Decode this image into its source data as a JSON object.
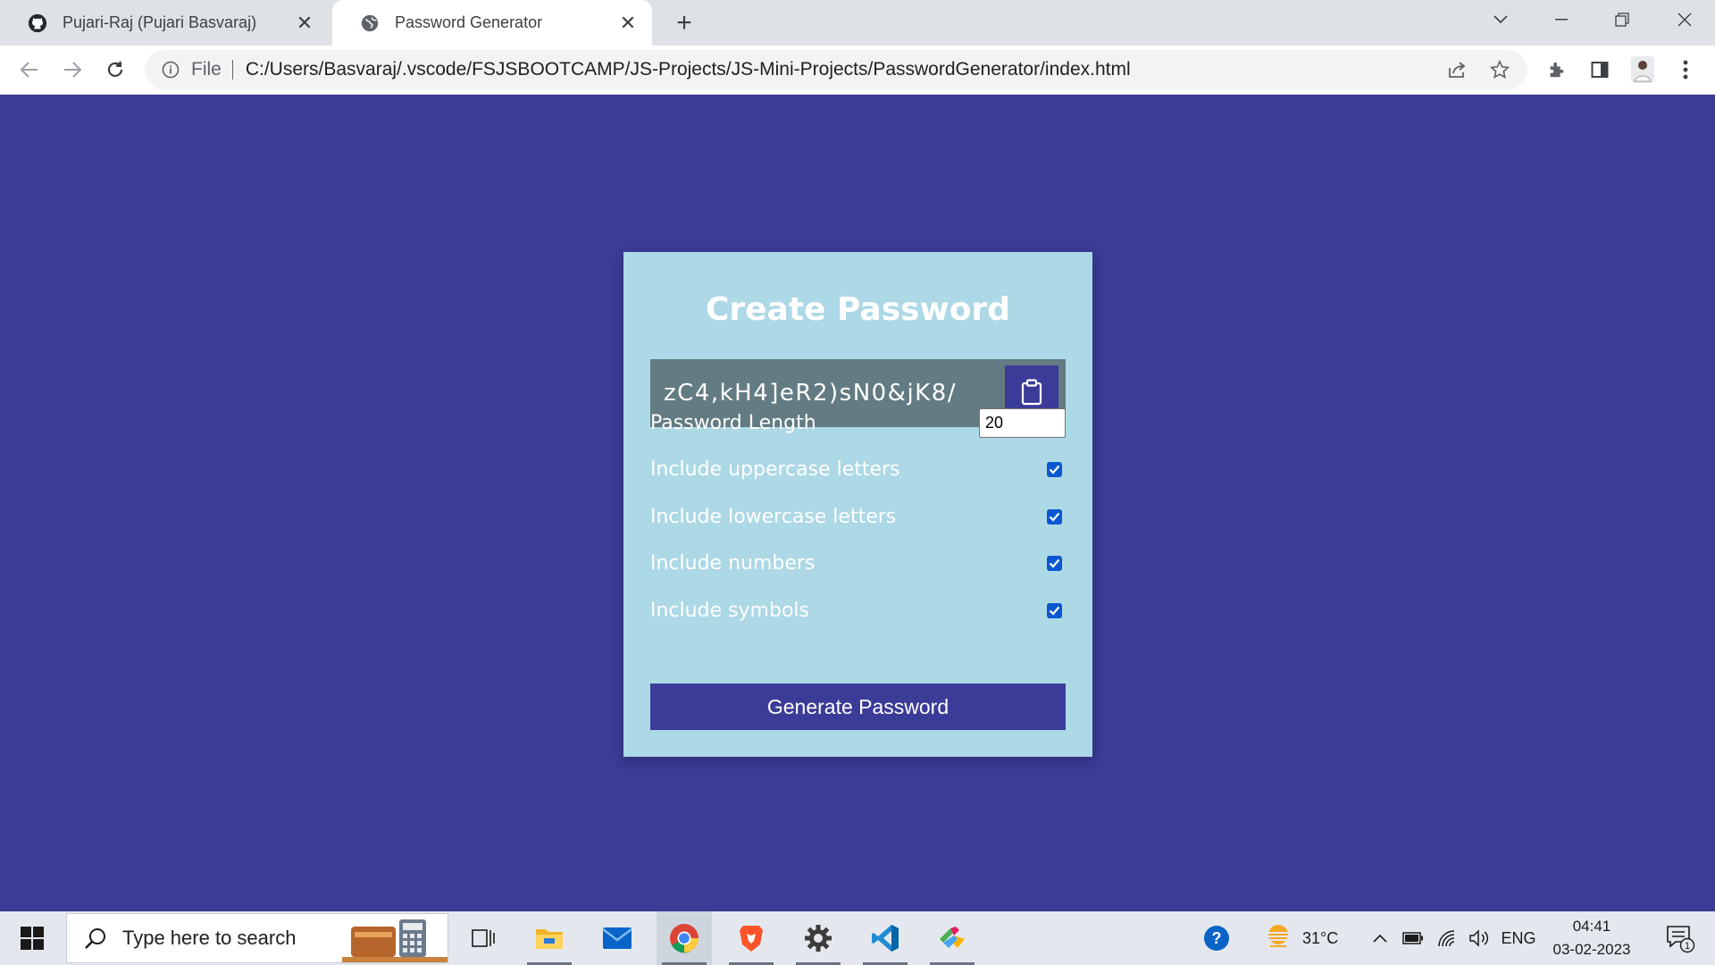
{
  "browser": {
    "tabs": [
      {
        "title": "Pujari-Raj (Pujari Basvaraj)",
        "favicon": "github-icon",
        "active": false
      },
      {
        "title": "Password Generator",
        "favicon": "globe-icon",
        "active": true
      }
    ],
    "omnibox": {
      "scheme_label": "File",
      "url": "C:/Users/Basvaraj/.vscode/FSJSBOOTCAMP/JS-Projects/JS-Mini-Projects/PasswordGenerator/index.html"
    }
  },
  "page": {
    "background_color": "#3b3b98",
    "card_color": "#add8e6",
    "title": "Create Password",
    "result": "zC4,kH4]eR2)sN0&jK8/",
    "settings": {
      "length_label": "Password Length",
      "length_value": "20",
      "uppercase_label": "Include uppercase letters",
      "uppercase_checked": true,
      "lowercase_label": "Include lowercase letters",
      "lowercase_checked": true,
      "numbers_label": "Include numbers",
      "numbers_checked": true,
      "symbols_label": "Include symbols",
      "symbols_checked": true
    },
    "generate_label": "Generate Password"
  },
  "taskbar": {
    "search_placeholder": "Type here to search",
    "apps": [
      "task-view-icon",
      "file-explorer-icon",
      "mail-icon",
      "chrome-icon",
      "brave-icon",
      "settings-icon",
      "vscode-icon",
      "git-icon"
    ],
    "weather": "31°C",
    "language": "ENG",
    "time": "04:41",
    "date": "03-02-2023",
    "notification_count": "1"
  }
}
